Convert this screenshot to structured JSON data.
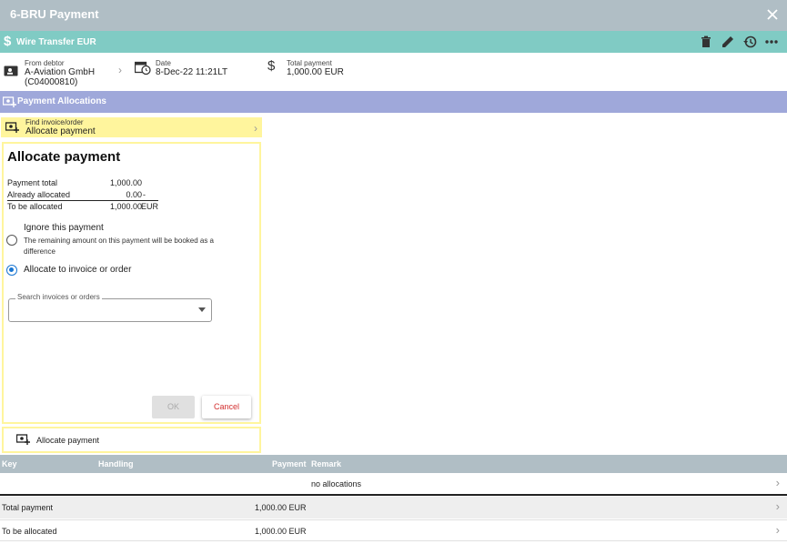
{
  "window": {
    "title": "6-BRU Payment"
  },
  "subheader": {
    "title": "Wire Transfer EUR"
  },
  "info": {
    "from_label": "From debtor",
    "from_value_1": "A-Aviation GmbH",
    "from_value_2": "(C04000810)",
    "date_label": "Date",
    "date_value": "8-Dec-22 11:21LT",
    "total_label": "Total payment",
    "total_value": "1,000.00 EUR"
  },
  "section": {
    "title": "Payment Allocations"
  },
  "find": {
    "label": "Find invoice/order",
    "value": "Allocate payment"
  },
  "panel": {
    "title": "Allocate payment",
    "rows": [
      {
        "key": "Payment total",
        "value": "1,000.00",
        "currency": ""
      },
      {
        "key": "Already allocated",
        "value": "0.00",
        "currency": "-"
      },
      {
        "key": "To be allocated",
        "value": "1,000.00",
        "currency": "EUR"
      }
    ],
    "option_ignore": "Ignore this payment",
    "option_ignore_desc": "The remaining amount on this payment will be booked as a difference",
    "option_allocate": "Allocate to invoice or order",
    "search_label": "Search invoices or orders",
    "ok_label": "OK",
    "cancel_label": "Cancel"
  },
  "allocate_bar": {
    "label": "Allocate payment"
  },
  "table": {
    "headers": {
      "key": "Key",
      "handling": "Handling",
      "payment": "Payment",
      "remark": "Remark"
    },
    "empty_remark": "no allocations",
    "total_label": "Total payment",
    "total_value": "1,000.00 EUR",
    "tba_label": "To be allocated",
    "tba_value": "1,000.00 EUR"
  },
  "colors": {
    "titlebar": "#b0bec5",
    "subheader": "#80cbc4",
    "section": "#9fa8da",
    "highlight": "#fff59d",
    "cancel": "#d32f2f",
    "radio_selected": "#1976d2"
  },
  "icons": [
    "close-icon",
    "dollar-icon",
    "trash-icon",
    "edit-icon",
    "history-icon",
    "more-icon",
    "contact-card-icon",
    "chevron-right-icon",
    "clock-calendar-icon",
    "add-payment-icon",
    "dropdown-arrow-icon"
  ]
}
